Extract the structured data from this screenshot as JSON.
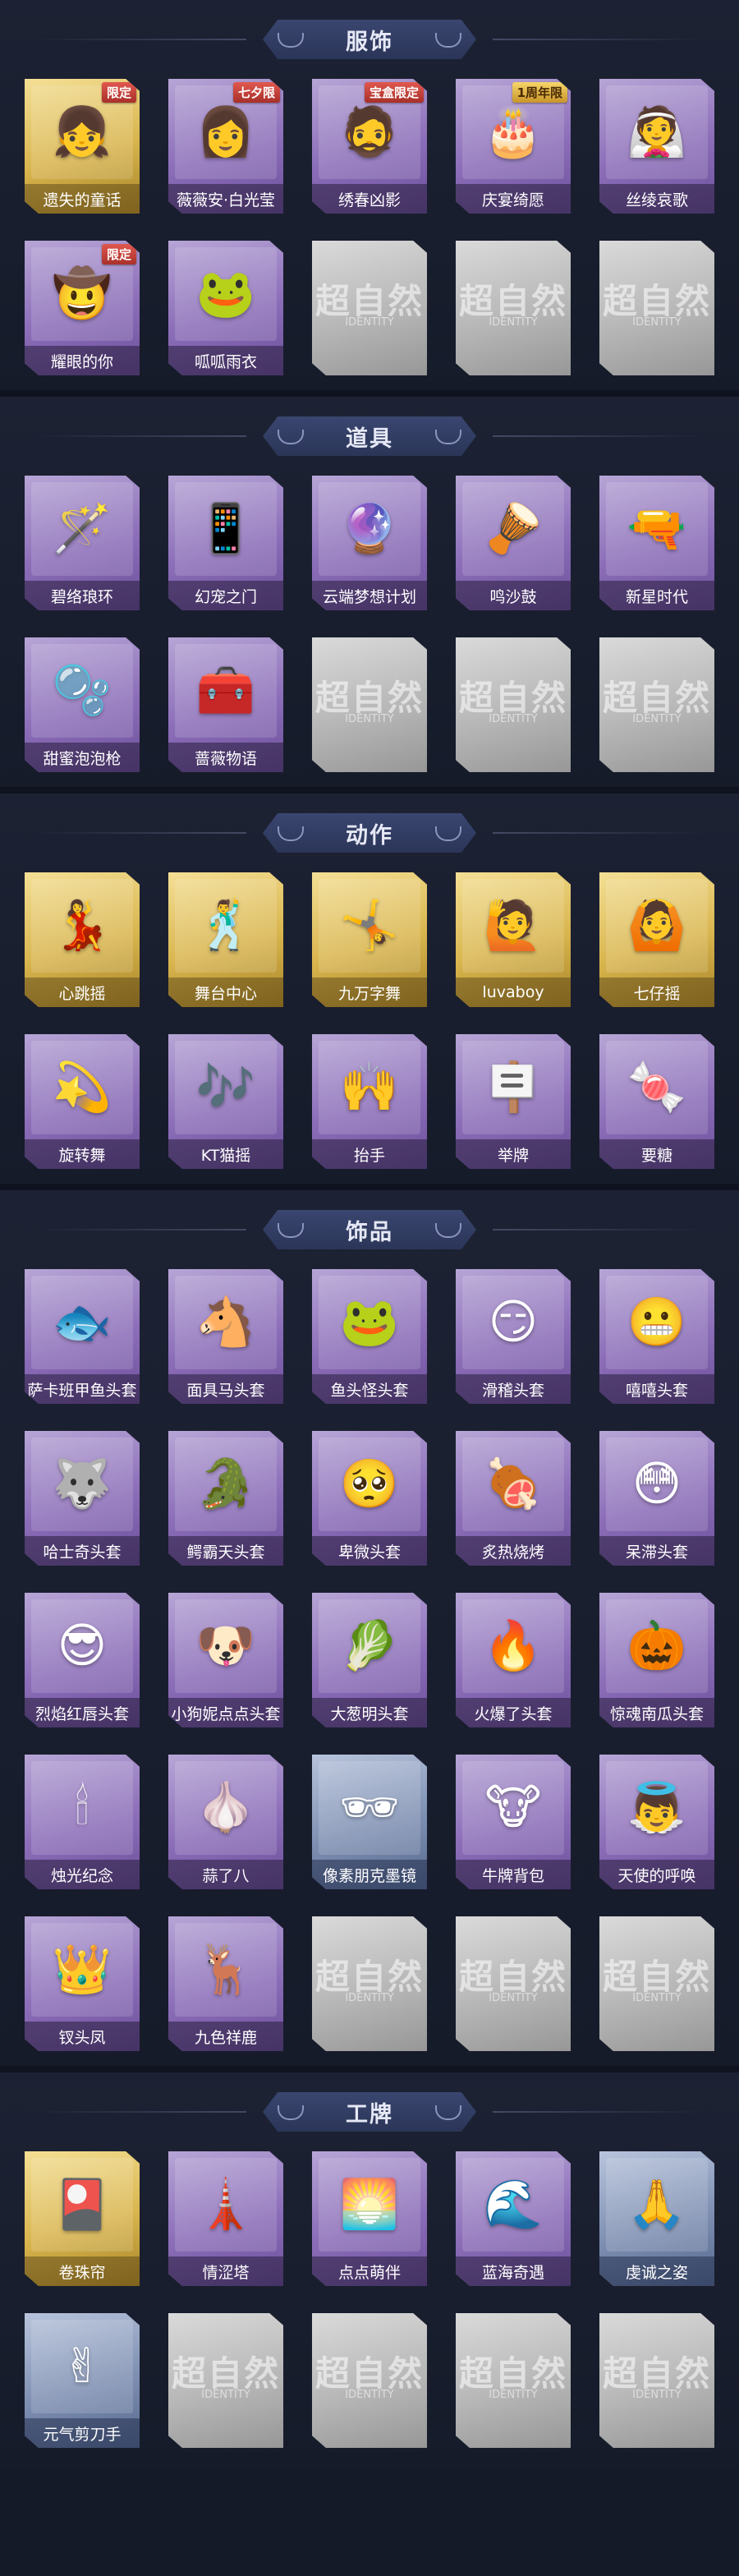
{
  "sections": [
    {
      "key": "clothing",
      "title": "服饰",
      "items": [
        {
          "label": "遗失的童话",
          "rarity": "gold",
          "icon": "doll-portrait-icon",
          "glyph": "👧",
          "badge": "限定"
        },
        {
          "label": "薇薇安·白光莹",
          "rarity": "purple",
          "icon": "girl-portrait-icon",
          "glyph": "👩",
          "badge": "七夕限"
        },
        {
          "label": "绣春凶影",
          "rarity": "purple",
          "icon": "swordsman-portrait-icon",
          "glyph": "🧔",
          "badge": "宝盒限定"
        },
        {
          "label": "庆宴绮愿",
          "rarity": "purple",
          "icon": "cake-party-portrait-icon",
          "glyph": "🎂",
          "badge": "1周年限"
        },
        {
          "label": "丝绫哀歌",
          "rarity": "purple",
          "icon": "veiled-girl-portrait-icon",
          "glyph": "👰",
          "badge": ""
        },
        {
          "label": "耀眼的你",
          "rarity": "purple",
          "icon": "cowgirl-portrait-icon",
          "glyph": "🤠",
          "badge": "限定"
        },
        {
          "label": "呱呱雨衣",
          "rarity": "purple",
          "icon": "frog-raincoat-portrait-icon",
          "glyph": "🐸",
          "badge": ""
        },
        {
          "label": "",
          "rarity": "empty",
          "icon": "placeholder-icon",
          "glyph": "",
          "badge": ""
        },
        {
          "label": "",
          "rarity": "empty",
          "icon": "placeholder-icon",
          "glyph": "",
          "badge": ""
        },
        {
          "label": "",
          "rarity": "empty",
          "icon": "placeholder-icon",
          "glyph": "",
          "badge": ""
        }
      ]
    },
    {
      "key": "props",
      "title": "道具",
      "items": [
        {
          "label": "碧络琅环",
          "rarity": "purple",
          "icon": "jade-staff-icon",
          "glyph": "🪄",
          "badge": ""
        },
        {
          "label": "幻宠之门",
          "rarity": "purple",
          "icon": "pet-device-icon",
          "glyph": "📱",
          "badge": ""
        },
        {
          "label": "云端梦想计划",
          "rarity": "purple",
          "icon": "scepter-icon",
          "glyph": "🔮",
          "badge": ""
        },
        {
          "label": "鸣沙鼓",
          "rarity": "purple",
          "icon": "drum-icon",
          "glyph": "🪘",
          "badge": ""
        },
        {
          "label": "新星时代",
          "rarity": "purple",
          "icon": "revolver-icon",
          "glyph": "🔫",
          "badge": ""
        },
        {
          "label": "甜蜜泡泡枪",
          "rarity": "purple",
          "icon": "bubble-gun-icon",
          "glyph": "🫧",
          "badge": ""
        },
        {
          "label": "蔷薇物语",
          "rarity": "purple",
          "icon": "medical-kit-icon",
          "glyph": "🧰",
          "badge": ""
        },
        {
          "label": "",
          "rarity": "empty",
          "icon": "placeholder-icon",
          "glyph": "",
          "badge": ""
        },
        {
          "label": "",
          "rarity": "empty",
          "icon": "placeholder-icon",
          "glyph": "",
          "badge": ""
        },
        {
          "label": "",
          "rarity": "empty",
          "icon": "placeholder-icon",
          "glyph": "",
          "badge": ""
        }
      ]
    },
    {
      "key": "actions",
      "title": "动作",
      "items": [
        {
          "label": "心跳摇",
          "rarity": "gold",
          "icon": "dance-pose-icon",
          "glyph": "💃",
          "badge": ""
        },
        {
          "label": "舞台中心",
          "rarity": "gold",
          "icon": "stage-pose-icon",
          "glyph": "🕺",
          "badge": ""
        },
        {
          "label": "九万字舞",
          "rarity": "gold",
          "icon": "spin-pose-icon",
          "glyph": "🤸",
          "badge": ""
        },
        {
          "label": "luvaboy",
          "rarity": "gold",
          "icon": "cool-pose-icon",
          "glyph": "🙋",
          "badge": ""
        },
        {
          "label": "七仔摇",
          "rarity": "gold",
          "icon": "sway-pose-icon",
          "glyph": "🙆",
          "badge": ""
        },
        {
          "label": "旋转舞",
          "rarity": "purple",
          "icon": "twirl-pose-icon",
          "glyph": "💫",
          "badge": ""
        },
        {
          "label": "KT猫摇",
          "rarity": "purple",
          "icon": "cat-dance-pose-icon",
          "glyph": "🎶",
          "badge": ""
        },
        {
          "label": "抬手",
          "rarity": "purple",
          "icon": "raise-hand-pose-icon",
          "glyph": "🙌",
          "badge": ""
        },
        {
          "label": "举牌",
          "rarity": "purple",
          "icon": "hold-sign-pose-icon",
          "glyph": "🪧",
          "badge": ""
        },
        {
          "label": "要糖",
          "rarity": "purple",
          "icon": "ask-candy-pose-icon",
          "glyph": "🍬",
          "badge": ""
        }
      ]
    },
    {
      "key": "accessories",
      "title": "饰品",
      "items": [
        {
          "label": "萨卡班甲鱼头套",
          "rarity": "purple",
          "icon": "fish-head-icon",
          "glyph": "🐟",
          "badge": ""
        },
        {
          "label": "面具马头套",
          "rarity": "purple",
          "icon": "horse-head-icon",
          "glyph": "🐴",
          "badge": ""
        },
        {
          "label": "鱼头怪头套",
          "rarity": "purple",
          "icon": "fish-monster-head-icon",
          "glyph": "🐸",
          "badge": ""
        },
        {
          "label": "滑稽头套",
          "rarity": "purple",
          "icon": "smirk-face-icon",
          "glyph": "😏",
          "badge": ""
        },
        {
          "label": "嘻嘻头套",
          "rarity": "purple",
          "icon": "grin-face-icon",
          "glyph": "😬",
          "badge": ""
        },
        {
          "label": "哈士奇头套",
          "rarity": "purple",
          "icon": "husky-head-icon",
          "glyph": "🐺",
          "badge": ""
        },
        {
          "label": "鳄霸天头套",
          "rarity": "purple",
          "icon": "crocodile-head-icon",
          "glyph": "🐊",
          "badge": ""
        },
        {
          "label": "卑微头套",
          "rarity": "purple",
          "icon": "pleading-face-icon",
          "glyph": "🥺",
          "badge": ""
        },
        {
          "label": "炙热烧烤",
          "rarity": "purple",
          "icon": "bbq-head-icon",
          "glyph": "🍖",
          "badge": ""
        },
        {
          "label": "呆滞头套",
          "rarity": "purple",
          "icon": "dazed-face-icon",
          "glyph": "😳",
          "badge": ""
        },
        {
          "label": "烈焰红唇头套",
          "rarity": "purple",
          "icon": "electric-mouse-head-icon",
          "glyph": "😎",
          "badge": ""
        },
        {
          "label": "小狗妮点点头套",
          "rarity": "purple",
          "icon": "puppy-head-icon",
          "glyph": "🐶",
          "badge": ""
        },
        {
          "label": "大葱明头套",
          "rarity": "purple",
          "icon": "scallion-head-icon",
          "glyph": "🥬",
          "badge": ""
        },
        {
          "label": "火爆了头套",
          "rarity": "purple",
          "icon": "flame-head-icon",
          "glyph": "🔥",
          "badge": ""
        },
        {
          "label": "惊魂南瓜头套",
          "rarity": "purple",
          "icon": "pumpkin-head-icon",
          "glyph": "🎃",
          "badge": ""
        },
        {
          "label": "烛光纪念",
          "rarity": "purple",
          "icon": "candle-head-icon",
          "glyph": "🕯",
          "badge": ""
        },
        {
          "label": "蒜了八",
          "rarity": "purple",
          "icon": "garlic-head-icon",
          "glyph": "🧄",
          "badge": ""
        },
        {
          "label": "像素朋克墨镜",
          "rarity": "blue",
          "icon": "pixel-sunglasses-icon",
          "glyph": "🕶",
          "badge": ""
        },
        {
          "label": "牛牌背包",
          "rarity": "purple",
          "icon": "cow-backpack-icon",
          "glyph": "🐮",
          "badge": ""
        },
        {
          "label": "天使的呼唤",
          "rarity": "purple",
          "icon": "angel-icon",
          "glyph": "👼",
          "badge": ""
        },
        {
          "label": "钗头凤",
          "rarity": "purple",
          "icon": "phoenix-headdress-icon",
          "glyph": "👑",
          "badge": ""
        },
        {
          "label": "九色祥鹿",
          "rarity": "purple",
          "icon": "deer-icon",
          "glyph": "🦌",
          "badge": ""
        },
        {
          "label": "",
          "rarity": "empty",
          "icon": "placeholder-icon",
          "glyph": "",
          "badge": ""
        },
        {
          "label": "",
          "rarity": "empty",
          "icon": "placeholder-icon",
          "glyph": "",
          "badge": ""
        },
        {
          "label": "",
          "rarity": "empty",
          "icon": "placeholder-icon",
          "glyph": "",
          "badge": ""
        }
      ]
    },
    {
      "key": "badges",
      "title": "工牌",
      "items": [
        {
          "label": "卷珠帘",
          "rarity": "gold",
          "icon": "badge-card-icon",
          "glyph": "🎴",
          "badge": ""
        },
        {
          "label": "情涩塔",
          "rarity": "purple",
          "icon": "tower-card-icon",
          "glyph": "🗼",
          "badge": ""
        },
        {
          "label": "点点萌伴",
          "rarity": "purple",
          "icon": "companion-card-icon",
          "glyph": "🌅",
          "badge": ""
        },
        {
          "label": "蓝海奇遇",
          "rarity": "purple",
          "icon": "ocean-card-icon",
          "glyph": "🌊",
          "badge": ""
        },
        {
          "label": "虔诚之姿",
          "rarity": "blue",
          "icon": "silhouette-card-icon",
          "glyph": "🙏",
          "badge": ""
        },
        {
          "label": "元气剪刀手",
          "rarity": "blue",
          "icon": "peace-sign-card-icon",
          "glyph": "✌",
          "badge": ""
        },
        {
          "label": "",
          "rarity": "empty",
          "icon": "placeholder-icon",
          "glyph": "",
          "badge": ""
        },
        {
          "label": "",
          "rarity": "empty",
          "icon": "placeholder-icon",
          "glyph": "",
          "badge": ""
        },
        {
          "label": "",
          "rarity": "empty",
          "icon": "placeholder-icon",
          "glyph": "",
          "badge": ""
        },
        {
          "label": "",
          "rarity": "empty",
          "icon": "placeholder-icon",
          "glyph": "",
          "badge": ""
        }
      ]
    }
  ],
  "placeholder": {
    "logo": "超自然",
    "sub": "IDENTITY"
  },
  "colors": {
    "background": "#151a29",
    "banner": "#2f3a60",
    "card_purple": "#8b6db8",
    "card_gold": "#d9b54e",
    "card_blue": "#7e8fb2",
    "card_empty": "#b7b7b7"
  }
}
